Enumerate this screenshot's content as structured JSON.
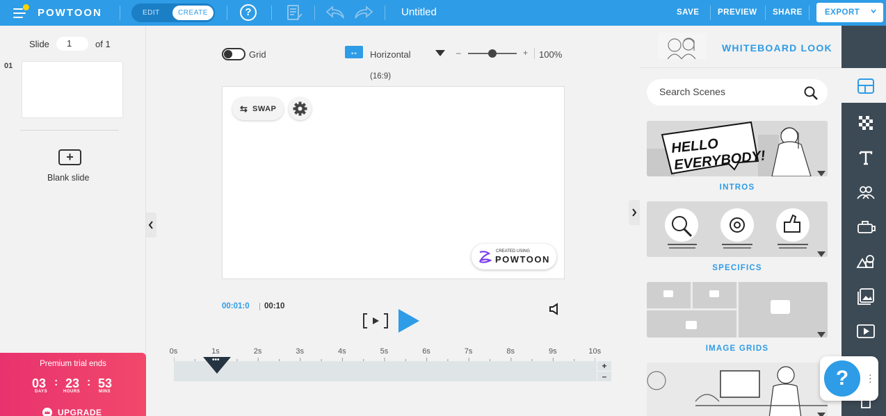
{
  "app": {
    "logo": "POWTOON",
    "title": "Untitled",
    "mode_edit": "EDIT",
    "mode_create": "CREATE",
    "help": "?",
    "save": "SAVE",
    "preview": "PREVIEW",
    "share": "SHARE",
    "export": "EXPORT",
    "accent": "#2e9ce6"
  },
  "left": {
    "slide_label": "Slide",
    "slide_value": "1",
    "slide_of": "of 1",
    "slide_number": "01",
    "blank_label": "Blank slide",
    "trial_title": "Premium trial ends",
    "days": "03",
    "hours": "23",
    "mins": "53",
    "days_label": "DAYS",
    "hours_label": "HOURS",
    "mins_label": "MINS",
    "upgrade": "UPGRADE"
  },
  "canvas": {
    "grid_label": "Grid",
    "grid_on": false,
    "orientation": "Horizontal",
    "zoom_minus": "–",
    "zoom_plus": "+",
    "zoom": "100%",
    "aspect": "(16:9)",
    "swap": "SWAP",
    "watermark_small": "CREATED USING",
    "watermark_big": "POWTOON"
  },
  "player": {
    "current": "00:01:0",
    "total": "00:10",
    "play_bracket": "[▸]"
  },
  "timeline": {
    "ticks": [
      "0s",
      "1s",
      "2s",
      "3s",
      "4s",
      "5s",
      "6s",
      "7s",
      "8s",
      "9s",
      "10s"
    ],
    "playhead_dots": "•••",
    "plus": "+",
    "minus": "–"
  },
  "right": {
    "style_name": "WHITEBOARD LOOK",
    "search_placeholder": "Search Scenes",
    "scenes": [
      {
        "label": "INTROS",
        "bubble": "HELLO EVERYBODY!"
      },
      {
        "label": "SPECIFICS"
      },
      {
        "label": "IMAGE GRIDS"
      }
    ]
  },
  "help_fab": "?"
}
